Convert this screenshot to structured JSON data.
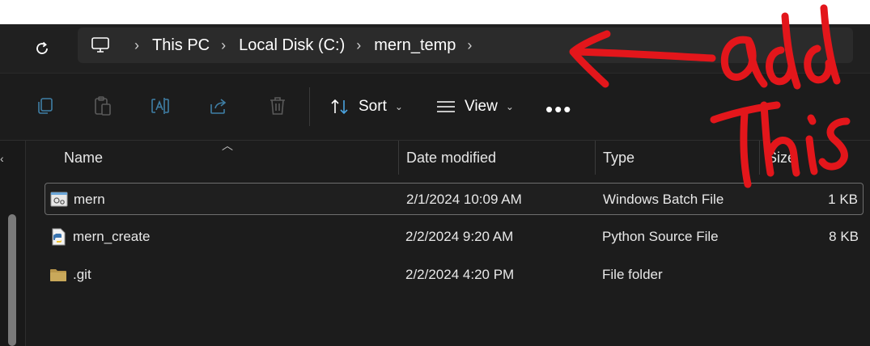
{
  "window": {
    "top_strip": ""
  },
  "address": {
    "breadcrumbs": [
      "This PC",
      "Local Disk (C:)",
      "mern_temp"
    ]
  },
  "toolbar": {
    "sort_label": "Sort",
    "view_label": "View",
    "more_label": "•••"
  },
  "columns": {
    "name": "Name",
    "date": "Date modified",
    "type": "Type",
    "size": "Size"
  },
  "files": [
    {
      "name": "mern",
      "date": "2/1/2024 10:09 AM",
      "type": "Windows Batch File",
      "size": "1 KB",
      "icon": "batch-file-icon",
      "selected": true
    },
    {
      "name": "mern_create",
      "date": "2/2/2024 9:20 AM",
      "type": "Python Source File",
      "size": "8 KB",
      "icon": "python-file-icon",
      "selected": false
    },
    {
      "name": ".git",
      "date": "2/2/2024 4:20 PM",
      "type": "File folder",
      "size": "",
      "icon": "folder-icon",
      "selected": false
    }
  ],
  "annotation": {
    "text": "add this",
    "color": "#e3161b"
  },
  "colors": {
    "background": "#1c1c1c",
    "addressbar": "#2b2b2b",
    "folder": "#c9a85a",
    "accent": "#4aa3df"
  }
}
